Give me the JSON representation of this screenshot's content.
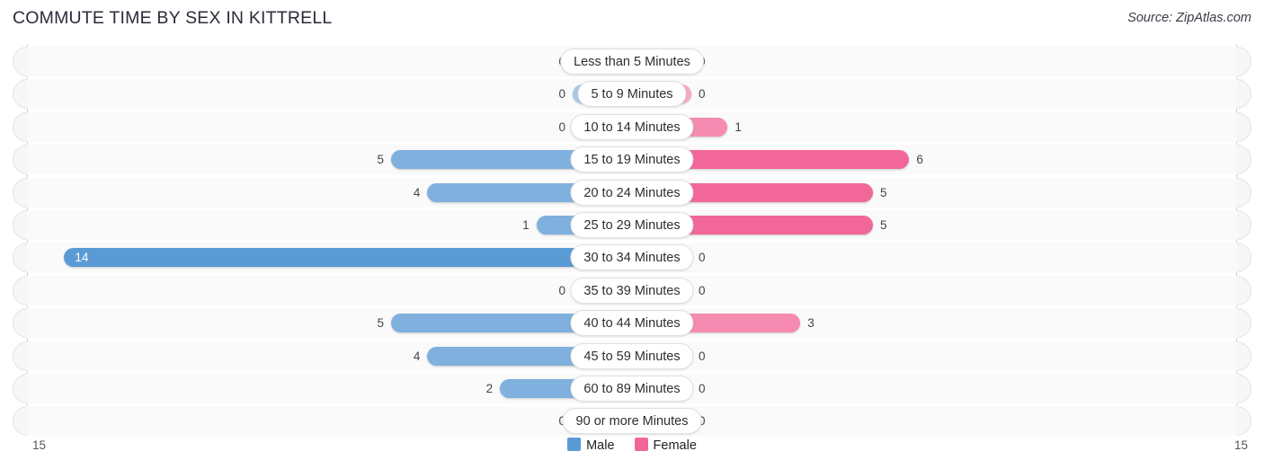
{
  "header": {
    "title": "COMMUTE TIME BY SEX IN KITTRELL",
    "source": "Source: ZipAtlas.com"
  },
  "legend": {
    "male_label": "Male",
    "female_label": "Female",
    "male_color": "#5b9bd5",
    "female_color": "#f2679a"
  },
  "axis": {
    "left_tick": "15",
    "right_tick": "15"
  },
  "chart_data": {
    "type": "bar",
    "title": "COMMUTE TIME BY SEX IN KITTRELL",
    "subtitle": "",
    "orientation": "horizontal-diverging",
    "xlabel": "",
    "ylabel": "",
    "xlim": [
      15,
      15
    ],
    "grid": false,
    "legend_position": "bottom-center",
    "categories": [
      "Less than 5 Minutes",
      "5 to 9 Minutes",
      "10 to 14 Minutes",
      "15 to 19 Minutes",
      "20 to 24 Minutes",
      "25 to 29 Minutes",
      "30 to 34 Minutes",
      "35 to 39 Minutes",
      "40 to 44 Minutes",
      "45 to 59 Minutes",
      "60 to 89 Minutes",
      "90 or more Minutes"
    ],
    "series": [
      {
        "name": "Male",
        "color": "#5b9bd5",
        "values": [
          0,
          0,
          0,
          5,
          4,
          1,
          14,
          0,
          5,
          4,
          2,
          0
        ]
      },
      {
        "name": "Female",
        "color": "#f2679a",
        "values": [
          0,
          0,
          1,
          6,
          5,
          5,
          0,
          0,
          3,
          0,
          0,
          0
        ]
      }
    ]
  },
  "rows": [
    {
      "category": "Less than 5 Minutes",
      "male": "0",
      "female": "0"
    },
    {
      "category": "5 to 9 Minutes",
      "male": "0",
      "female": "0"
    },
    {
      "category": "10 to 14 Minutes",
      "male": "0",
      "female": "1"
    },
    {
      "category": "15 to 19 Minutes",
      "male": "5",
      "female": "6"
    },
    {
      "category": "20 to 24 Minutes",
      "male": "4",
      "female": "5"
    },
    {
      "category": "25 to 29 Minutes",
      "male": "1",
      "female": "5"
    },
    {
      "category": "30 to 34 Minutes",
      "male": "14",
      "female": "0"
    },
    {
      "category": "35 to 39 Minutes",
      "male": "0",
      "female": "0"
    },
    {
      "category": "40 to 44 Minutes",
      "male": "5",
      "female": "3"
    },
    {
      "category": "45 to 59 Minutes",
      "male": "4",
      "female": "0"
    },
    {
      "category": "60 to 89 Minutes",
      "male": "2",
      "female": "0"
    },
    {
      "category": "90 or more Minutes",
      "male": "0",
      "female": "0"
    }
  ]
}
